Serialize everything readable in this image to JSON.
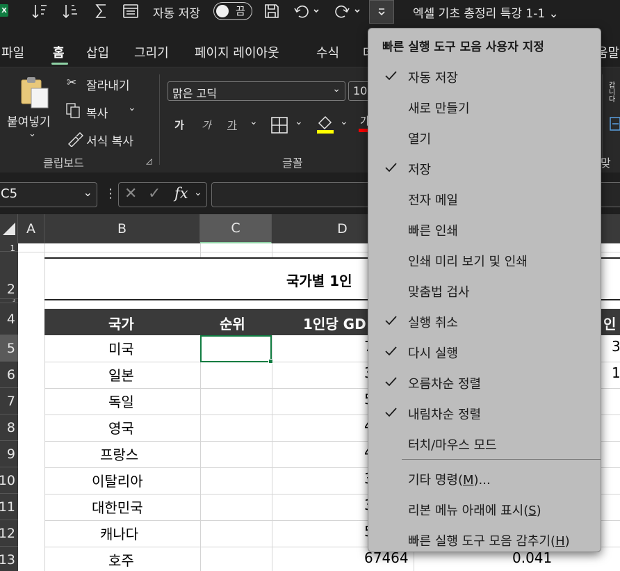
{
  "titlebar": {
    "app_logo": "X",
    "autosave_label": "자동 저장",
    "autosave_state": "끔",
    "document_title": "엑셀 기초 총정리 특강 1-1 ⌄"
  },
  "ribbon_tabs": [
    {
      "label": "파일"
    },
    {
      "label": "홈"
    },
    {
      "label": "삽입"
    },
    {
      "label": "그리기"
    },
    {
      "label": "페이지 레이아웃"
    },
    {
      "label": "수식"
    },
    {
      "label": "데"
    },
    {
      "label": "움말"
    }
  ],
  "ribbon": {
    "clipboard": {
      "paste_label": "붙여넣기",
      "cut_label": "잘라내기",
      "copy_label": "복사",
      "format_painter_label": "서식 복사",
      "group_label": "클립보드"
    },
    "font": {
      "font_name": "맑은 고딕",
      "font_size": "10",
      "bold": "가",
      "italic": "가",
      "underline": "가",
      "group_label": "글꼴",
      "font_color_glyph": "가"
    },
    "alignment": {
      "group_label": "맞춤",
      "wrap_label": "갑니 다"
    },
    "colors": {
      "fill_underline": "#ffff00",
      "font_underline": "#ff0000",
      "accent": "#107c41"
    }
  },
  "formula_bar": {
    "name_box": "C5",
    "fx_symbol": "fx",
    "formula": ""
  },
  "grid": {
    "columns": [
      "A",
      "B",
      "C",
      "D"
    ],
    "rows": [
      "1",
      "2",
      "3",
      "4",
      "5",
      "6",
      "7",
      "8",
      "9",
      "10",
      "11",
      "12",
      "13"
    ],
    "title_fragment": "국가별 1인",
    "header": {
      "country": "국가",
      "rank": "순위",
      "gdp": "1인당 GD",
      "growth": "인"
    },
    "countries": [
      "미국",
      "일본",
      "독일",
      "영국",
      "프랑스",
      "이탈리아",
      "대한민국",
      "캐나다",
      "호주"
    ],
    "d_fragments": [
      "7",
      "3",
      "5",
      "4",
      "4",
      "3",
      "3",
      "5",
      "67464"
    ],
    "e_fragments": [
      "3",
      "1"
    ],
    "last_row_growth": "0.041"
  },
  "qat_menu": {
    "title": "빠른 실행 도구 모음 사용자 지정",
    "items": [
      {
        "label": "자동 저장",
        "checked": true
      },
      {
        "label": "새로 만들기",
        "checked": false
      },
      {
        "label": "열기",
        "checked": false
      },
      {
        "label": "저장",
        "checked": true
      },
      {
        "label": "전자 메일",
        "checked": false
      },
      {
        "label": "빠른 인쇄",
        "checked": false
      },
      {
        "label": "인쇄 미리 보기 및 인쇄",
        "checked": false
      },
      {
        "label": "맞춤법 검사",
        "checked": false
      },
      {
        "label": "실행 취소",
        "checked": true
      },
      {
        "label": "다시 실행",
        "checked": true
      },
      {
        "label": "오름차순 정렬",
        "checked": true
      },
      {
        "label": "내림차순 정렬",
        "checked": true
      },
      {
        "label": "터치/마우스 모드",
        "checked": false
      }
    ],
    "more_commands": {
      "text": "기타 명령(",
      "key": "M",
      "suffix": ")..."
    },
    "show_below": {
      "text": "리본 메뉴 아래에 표시(",
      "key": "S",
      "suffix": ")"
    },
    "hide_toolbar": {
      "text": "빠른 실행 도구 모음 감추기(",
      "key": "H",
      "suffix": ")"
    }
  }
}
